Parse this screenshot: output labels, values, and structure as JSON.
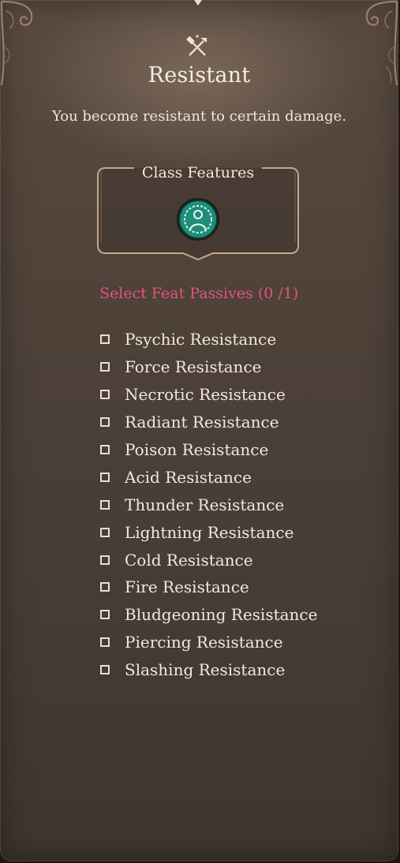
{
  "panel": {
    "icon": "crossed-axes-hammer-icon",
    "title": "Resistant",
    "description": "You become resistant to certain damage."
  },
  "class_features": {
    "title": "Class Features",
    "icon": "resistance-aura-icon",
    "icon_color": "#1f8d7a"
  },
  "feat_passives": {
    "header": "Select Feat Passives  (0 /1)",
    "header_color": "#e0557a",
    "selected_count": 0,
    "max_count": 1,
    "options": [
      {
        "label": "Psychic Resistance",
        "checked": false
      },
      {
        "label": "Force Resistance",
        "checked": false
      },
      {
        "label": "Necrotic Resistance",
        "checked": false
      },
      {
        "label": "Radiant Resistance",
        "checked": false
      },
      {
        "label": "Poison Resistance",
        "checked": false
      },
      {
        "label": "Acid Resistance",
        "checked": false
      },
      {
        "label": "Thunder Resistance",
        "checked": false
      },
      {
        "label": "Lightning Resistance",
        "checked": false
      },
      {
        "label": "Cold Resistance",
        "checked": false
      },
      {
        "label": "Fire Resistance",
        "checked": false
      },
      {
        "label": "Bludgeoning Resistance",
        "checked": false
      },
      {
        "label": "Piercing Resistance",
        "checked": false
      },
      {
        "label": "Slashing Resistance",
        "checked": false
      }
    ]
  }
}
